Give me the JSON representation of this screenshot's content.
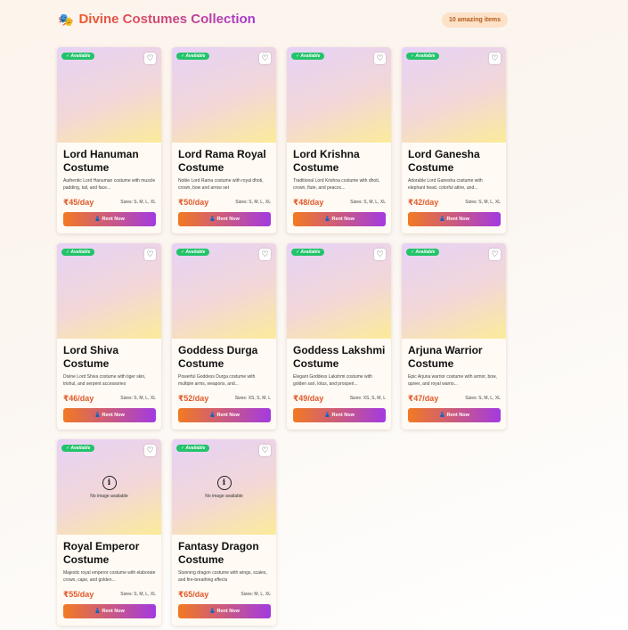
{
  "header": {
    "icon": "🎭",
    "title": "Divine Costumes Collection",
    "count_badge": "10 amazing items"
  },
  "card_common": {
    "available_label": "✓ Available",
    "favorite_icon": "heart-icon",
    "rent_label": "👗 Rent Now",
    "no_image_icon": "i",
    "no_image_text": "No image available"
  },
  "colors": {
    "title_gradient_start": "#f05a28",
    "title_gradient_end": "#a535d6",
    "available_badge": "#22c36b",
    "price": "#e05a2b",
    "button_gradient_start": "#f27a22",
    "button_gradient_end": "#a33ae0"
  },
  "items": [
    {
      "name": "Lord Hanuman Costume",
      "desc": "Authentic Lord Hanuman costume with muscle padding, tail, and face...",
      "price": "₹45/day",
      "sizes": "Sizes: S, M, L, XL",
      "has_image": true
    },
    {
      "name": "Lord Rama Royal Costume",
      "desc": "Noble Lord Rama costume with royal dhoti, crown, bow and arrow set",
      "price": "₹50/day",
      "sizes": "Sizes: S, M, L, XL",
      "has_image": true
    },
    {
      "name": "Lord Krishna Costume",
      "desc": "Traditional Lord Krishna costume with dhoti, crown, flute, and peacoc...",
      "price": "₹48/day",
      "sizes": "Sizes: S, M, L, XL",
      "has_image": true
    },
    {
      "name": "Lord Ganesha Costume",
      "desc": "Adorable Lord Ganesha costume with elephant head, colorful attire, and...",
      "price": "₹42/day",
      "sizes": "Sizes: S, M, L, XL",
      "has_image": true
    },
    {
      "name": "Lord Shiva Costume",
      "desc": "Divine Lord Shiva costume with tiger skin, trishul, and serpent accessories",
      "price": "₹46/day",
      "sizes": "Sizes: S, M, L, XL",
      "has_image": true
    },
    {
      "name": "Goddess Durga Costume",
      "desc": "Powerful Goddess Durga costume with multiple arms, weapons, and...",
      "price": "₹52/day",
      "sizes": "Sizes: XS, S, M, L",
      "has_image": true
    },
    {
      "name": "Goddess Lakshmi Costume",
      "desc": "Elegant Goddess Lakshmi costume with golden sari, lotus, and prosperi...",
      "price": "₹49/day",
      "sizes": "Sizes: XS, S, M, L",
      "has_image": true
    },
    {
      "name": "Arjuna Warrior Costume",
      "desc": "Epic Arjuna warrior costume with armor, bow, quiver, and royal warrio...",
      "price": "₹47/day",
      "sizes": "Sizes: S, M, L, XL",
      "has_image": true
    },
    {
      "name": "Royal Emperor Costume",
      "desc": "Majestic royal emperor costume with elaborate crown, cape, and golden...",
      "price": "₹55/day",
      "sizes": "Sizes: S, M, L, XL",
      "has_image": false
    },
    {
      "name": "Fantasy Dragon Costume",
      "desc": "Stunning dragon costume with wings, scales, and fire-breathing effects",
      "price": "₹65/day",
      "sizes": "Sizes: M, L, XL",
      "has_image": false
    }
  ]
}
